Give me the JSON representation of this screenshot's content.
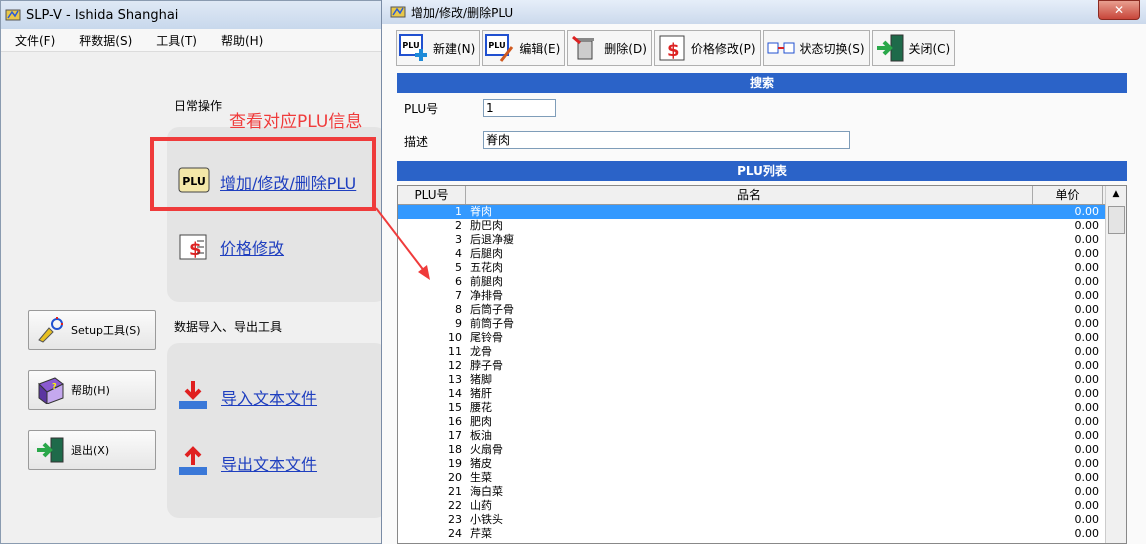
{
  "main_window": {
    "title": "SLP-V - Ishida Shanghai",
    "menu": [
      "文件(F)",
      "秤数据(S)",
      "工具(T)",
      "帮助(H)"
    ],
    "daily_ops_label": "日常操作",
    "plu_link": "增加/修改/删除PLU",
    "price_link": "价格修改",
    "data_tools_label": "数据导入、导出工具",
    "import_link": "导入文本文件",
    "export_link": "导出文本文件",
    "setup_button": "Setup工具(S)",
    "help_button": "帮助(H)",
    "exit_button": "退出(X)"
  },
  "annotation": {
    "text": "查看对应PLU信息",
    "color": "#ef3b3b"
  },
  "plu_window": {
    "title": "增加/修改/删除PLU",
    "toolbar": [
      "新建(N)",
      "编辑(E)",
      "删除(D)",
      "价格修改(P)",
      "状态切换(S)",
      "关闭(C)"
    ],
    "search_header": "搜索",
    "plu_no_label": "PLU号",
    "plu_no_value": "1",
    "desc_label": "描述",
    "desc_value": "脊肉",
    "list_header": "PLU列表",
    "columns": [
      "PLU号",
      "品名",
      "单价"
    ],
    "rows": [
      {
        "no": "1",
        "name": "脊肉",
        "price": "0.00"
      },
      {
        "no": "2",
        "name": "肋巴肉",
        "price": "0.00"
      },
      {
        "no": "3",
        "name": "后退净瘦",
        "price": "0.00"
      },
      {
        "no": "4",
        "name": "后腿肉",
        "price": "0.00"
      },
      {
        "no": "5",
        "name": "五花肉",
        "price": "0.00"
      },
      {
        "no": "6",
        "name": "前腿肉",
        "price": "0.00"
      },
      {
        "no": "7",
        "name": "净排骨",
        "price": "0.00"
      },
      {
        "no": "8",
        "name": "后筒子骨",
        "price": "0.00"
      },
      {
        "no": "9",
        "name": "前筒子骨",
        "price": "0.00"
      },
      {
        "no": "10",
        "name": "尾铃骨",
        "price": "0.00"
      },
      {
        "no": "11",
        "name": "龙骨",
        "price": "0.00"
      },
      {
        "no": "12",
        "name": "脖子骨",
        "price": "0.00"
      },
      {
        "no": "13",
        "name": "猪脚",
        "price": "0.00"
      },
      {
        "no": "14",
        "name": "猪肝",
        "price": "0.00"
      },
      {
        "no": "15",
        "name": "腰花",
        "price": "0.00"
      },
      {
        "no": "16",
        "name": "肥肉",
        "price": "0.00"
      },
      {
        "no": "17",
        "name": "板油",
        "price": "0.00"
      },
      {
        "no": "18",
        "name": "火扇骨",
        "price": "0.00"
      },
      {
        "no": "19",
        "name": "猪皮",
        "price": "0.00"
      },
      {
        "no": "20",
        "name": "生菜",
        "price": "0.00"
      },
      {
        "no": "21",
        "name": "海白菜",
        "price": "0.00"
      },
      {
        "no": "22",
        "name": "山药",
        "price": "0.00"
      },
      {
        "no": "23",
        "name": "小铁头",
        "price": "0.00"
      },
      {
        "no": "24",
        "name": "芹菜",
        "price": "0.00"
      }
    ],
    "accent": "#2b63c8",
    "selected_row": "#3399ff"
  }
}
